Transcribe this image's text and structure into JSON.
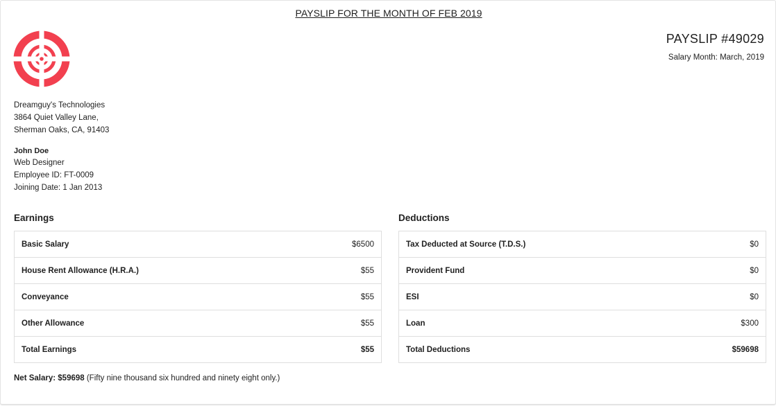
{
  "title": "PAYSLIP FOR THE MONTH OF FEB 2019",
  "payslip_number": "PAYSLIP #49029",
  "salary_month": "Salary Month: March, 2019",
  "company": {
    "name": "Dreamguy's Technologies",
    "address_line1": "3864 Quiet Valley Lane,",
    "address_line2": "Sherman Oaks, CA, 91403"
  },
  "employee": {
    "name": "John Doe",
    "role": "Web Designer",
    "id": "Employee ID: FT-0009",
    "joining": "Joining Date: 1 Jan 2013"
  },
  "earnings": {
    "title": "Earnings",
    "rows": [
      {
        "label": "Basic Salary",
        "amount": "$6500"
      },
      {
        "label": "House Rent Allowance (H.R.A.)",
        "amount": "$55"
      },
      {
        "label": "Conveyance",
        "amount": "$55"
      },
      {
        "label": "Other Allowance",
        "amount": "$55"
      },
      {
        "label": "Total Earnings",
        "amount": "$55"
      }
    ]
  },
  "deductions": {
    "title": "Deductions",
    "rows": [
      {
        "label": "Tax Deducted at Source (T.D.S.)",
        "amount": "$0"
      },
      {
        "label": "Provident Fund",
        "amount": "$0"
      },
      {
        "label": "ESI",
        "amount": "$0"
      },
      {
        "label": "Loan",
        "amount": "$300"
      },
      {
        "label": "Total Deductions",
        "amount": "$59698"
      }
    ]
  },
  "net_salary": {
    "label": "Net Salary: $59698",
    "words": " (Fifty nine thousand six hundred and ninety eight only.)"
  },
  "colors": {
    "logo": "#f2404f",
    "border": "#dedede"
  },
  "icons": {
    "logo": "target-logo-icon"
  }
}
